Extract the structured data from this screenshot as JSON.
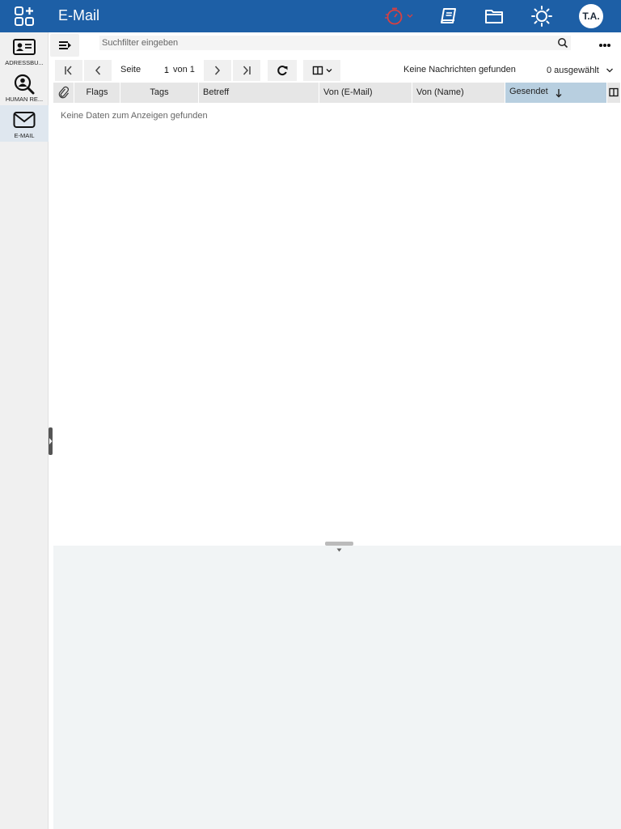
{
  "header": {
    "title": "E-Mail",
    "avatar_initials": "T.A.",
    "icons": [
      "apps-icon",
      "timer-icon",
      "book-icon",
      "folder-icon",
      "sun-icon"
    ],
    "accent_color": "#1d5fa6",
    "timer_color": "#d94040"
  },
  "sidebar": {
    "items": [
      {
        "label": "ADRESSBU...",
        "icon": "address-card-icon"
      },
      {
        "label": "HUMAN RE...",
        "icon": "search-person-icon"
      },
      {
        "label": "E-MAIL",
        "icon": "envelope-icon",
        "active": true
      }
    ]
  },
  "toolbar": {
    "search_placeholder": "Suchfilter eingeben",
    "page_label": "Seite",
    "page_value": "1",
    "page_of": "von 1",
    "status": "Keine Nachrichten gefunden",
    "selected": "0 ausgewählt"
  },
  "grid": {
    "columns": [
      "Flags",
      "Tags",
      "Betreff",
      "Von (E-Mail)",
      "Von (Name)",
      "Gesendet"
    ],
    "sorted_column": "Gesendet",
    "sort_direction": "descending",
    "empty_message": "Keine Daten zum Anzeigen gefunden"
  }
}
